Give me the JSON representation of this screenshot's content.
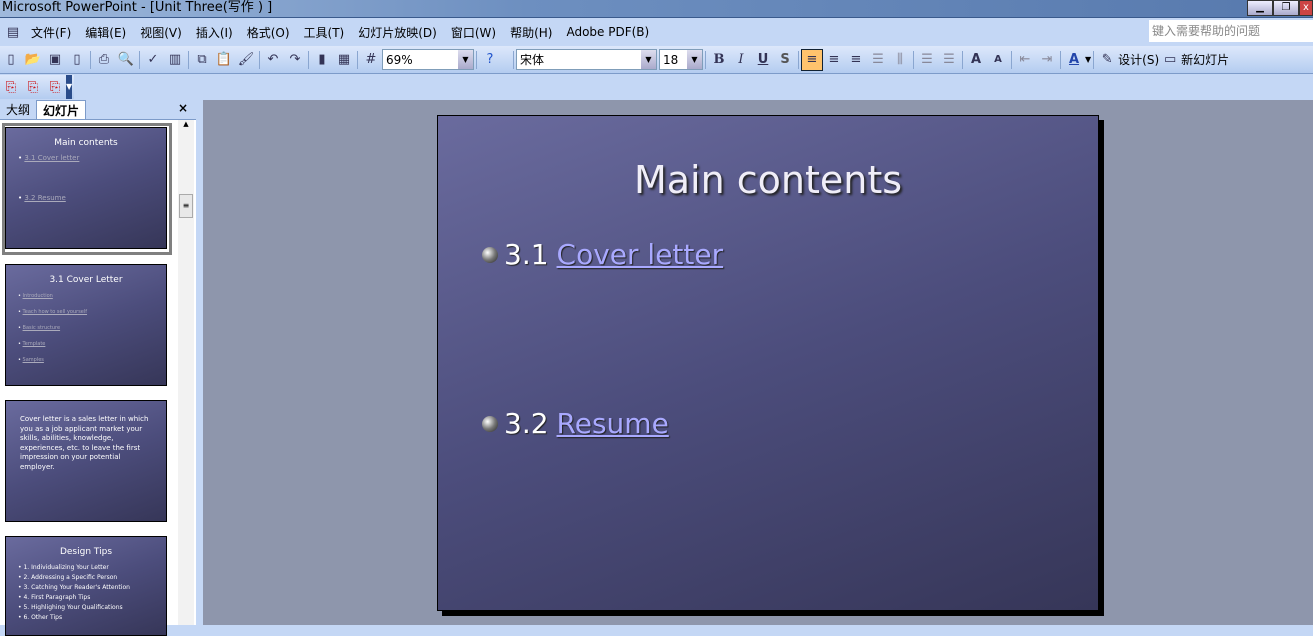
{
  "window": {
    "title": "Microsoft PowerPoint - [Unit Three(写作 ) ]"
  },
  "menu": [
    "文件(F)",
    "编辑(E)",
    "视图(V)",
    "插入(I)",
    "格式(O)",
    "工具(T)",
    "幻灯片放映(D)",
    "窗口(W)",
    "帮助(H)",
    "Adobe PDF(B)"
  ],
  "help_placeholder": "键入需要帮助的问题",
  "toolbar": {
    "zoom": "69%",
    "font": "宋体",
    "size": "18",
    "bold": "B",
    "italic": "I",
    "underline": "U",
    "shadow": "S",
    "design": "设计(S)",
    "new_slide": "新幻灯片"
  },
  "panel": {
    "tabs": [
      "大纲",
      "幻灯片"
    ],
    "close": "×"
  },
  "thumbnails": [
    {
      "title": "Main contents",
      "items": [
        "3.1 Cover letter",
        "3.2 Resume"
      ]
    },
    {
      "title": "3.1 Cover Letter",
      "items": [
        "Introduction",
        "Teach how to sell yourself",
        "Basic structure",
        "Template",
        "Samples"
      ]
    },
    {
      "body": "Cover letter is a sales letter in which you as a job applicant market your skills, abilities, knowledge, experiences, etc. to leave the first impression on your potential employer."
    },
    {
      "title": "Design  Tips",
      "items": [
        "1. Individualizing Your Letter",
        "2. Addressing a Specific Person",
        "3. Catching Your Reader's Attention",
        "4. First Paragraph Tips",
        "5. Highlighing Your Qualifications",
        "6. Other Tips"
      ]
    }
  ],
  "slide": {
    "title": "Main contents",
    "items": [
      {
        "num": "3.1",
        "link": "Cover letter"
      },
      {
        "num": "3.2",
        "link": "Resume"
      }
    ]
  }
}
